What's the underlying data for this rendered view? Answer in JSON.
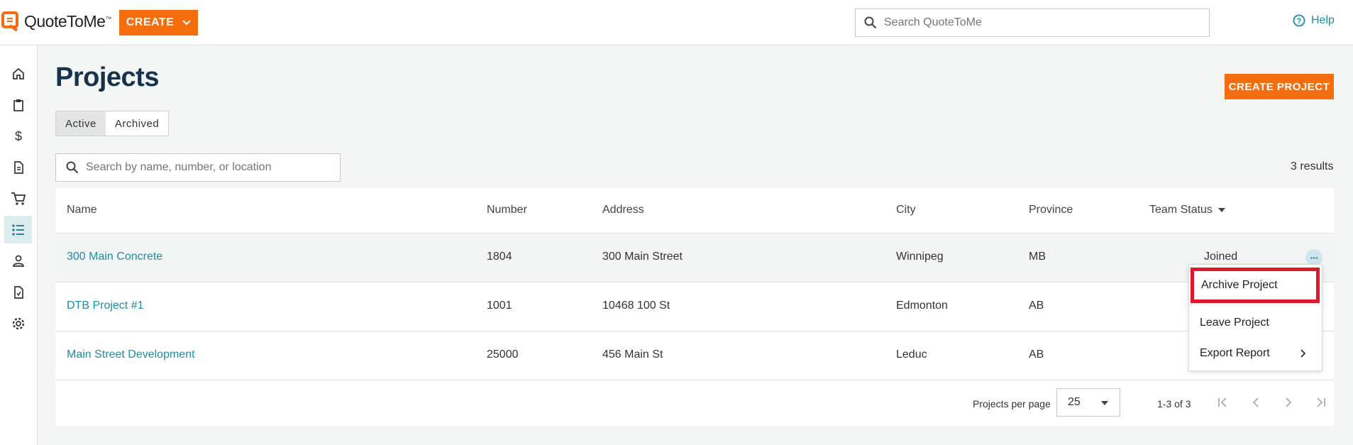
{
  "app": {
    "logo_text": "QuoteToMe",
    "logo_tm": "™",
    "create_label": "CREATE",
    "search_placeholder": "Search QuoteToMe",
    "help_label": "Help",
    "brand_color": "#f56d0c",
    "link_color": "#1a8fa6"
  },
  "sidebar": {
    "items": [
      {
        "icon": "home-icon"
      },
      {
        "icon": "clipboard-icon"
      },
      {
        "icon": "dollar-icon"
      },
      {
        "icon": "document-icon"
      },
      {
        "icon": "cart-icon"
      },
      {
        "icon": "list-icon",
        "active": true
      },
      {
        "icon": "person-icon"
      },
      {
        "icon": "report-icon"
      },
      {
        "icon": "gear-icon"
      }
    ]
  },
  "page": {
    "title": "Projects",
    "create_project_label": "CREATE PROJECT",
    "tabs": {
      "active": "Active",
      "archived": "Archived",
      "selected": "Active"
    },
    "search_placeholder": "Search by name, number, or location",
    "results": "3 results"
  },
  "table": {
    "headers": {
      "name": "Name",
      "number": "Number",
      "address": "Address",
      "city": "City",
      "province": "Province",
      "team_status": "Team Status"
    },
    "rows": [
      {
        "name": "300 Main Concrete",
        "number": "1804",
        "address": "300 Main Street",
        "city": "Winnipeg",
        "province": "MB",
        "team_status": "Joined"
      },
      {
        "name": "DTB Project #1",
        "number": "1001",
        "address": "10468 100 St",
        "city": "Edmonton",
        "province": "AB",
        "team_status": ""
      },
      {
        "name": "Main Street Development",
        "number": "25000",
        "address": "456 Main St",
        "city": "Leduc",
        "province": "AB",
        "team_status": ""
      }
    ],
    "more_label": "···"
  },
  "pagination": {
    "per_page_label": "Projects per page",
    "per_page_value": "25",
    "range": "1-3 of 3"
  },
  "menu": {
    "items": [
      "Archive Project",
      "Leave Project",
      "Export Report"
    ],
    "highlight_color": "#e0162b"
  }
}
